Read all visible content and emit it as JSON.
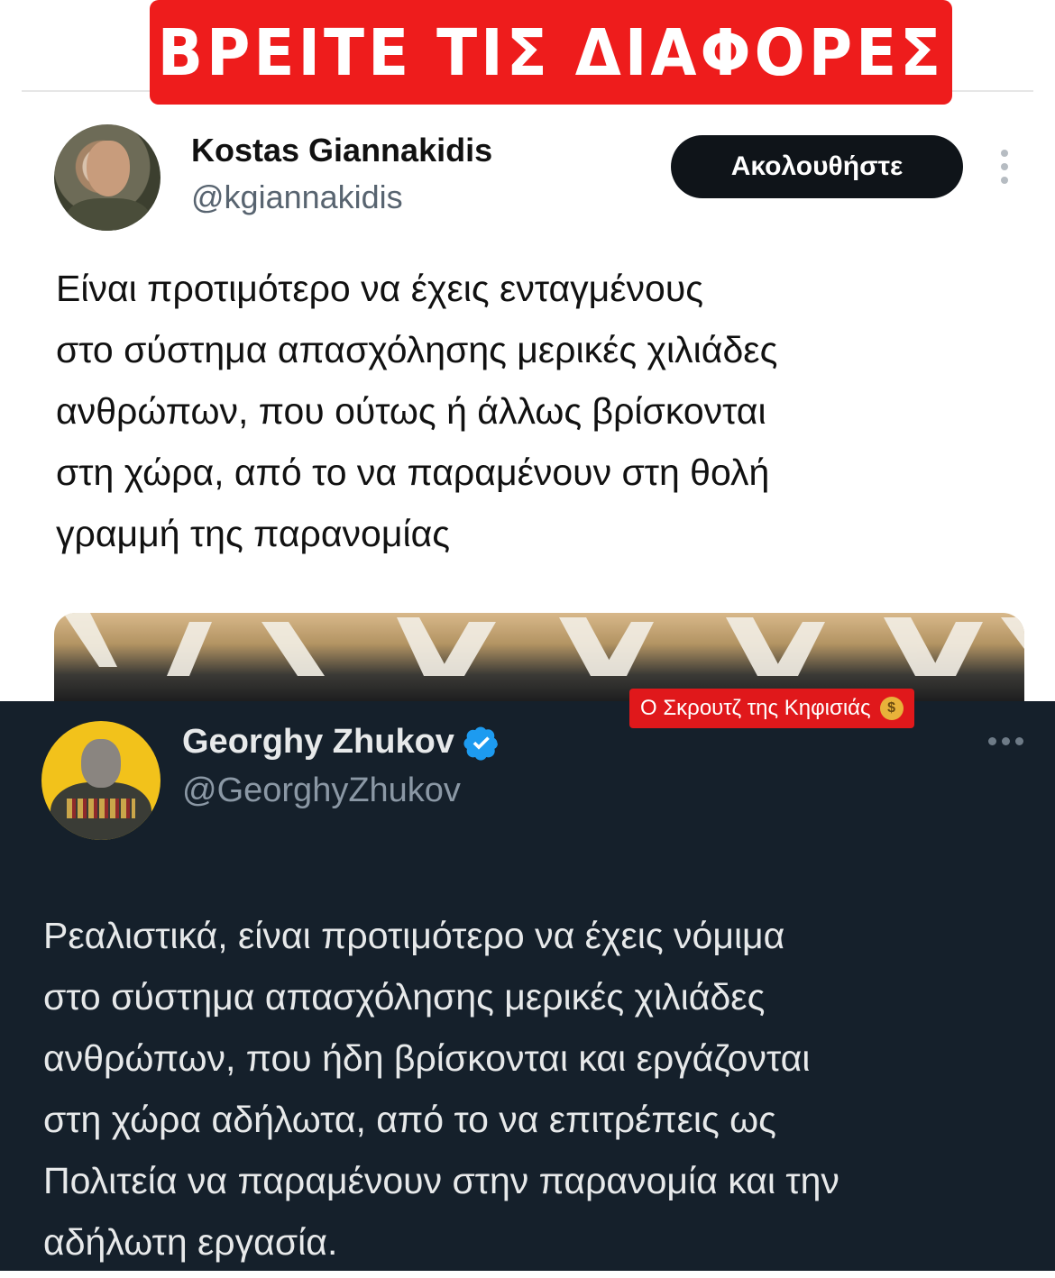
{
  "banner": {
    "title": "ΒΡΕΙΤΕ ΤΙΣ ΔΙΑΦΟΡΕΣ"
  },
  "tweet_light": {
    "author": "Kostas Giannakidis",
    "handle": "@kgiannakidis",
    "follow_label": "Ακολουθήστε",
    "avatar_icon": "profile-photo-icon",
    "more_icon": "more-vertical-icon",
    "text_lines": [
      "Είναι προτιμότερο να έχεις ενταγμένους",
      "στο σύστημα απασχόλησης μερικές χιλιάδες",
      "ανθρώπων, που ούτως ή άλλως βρίσκονται",
      "στη χώρα, από το να παραμένουν στη θολή",
      "γραμμή της παρανομίας"
    ]
  },
  "watermark": {
    "label": "Ο Σκρουτζ της Κηφισιάς",
    "icon": "money-bag-icon"
  },
  "tweet_dark": {
    "author": "Georghy Zhukov",
    "handle": "@GeorghyZhukov",
    "verified_icon": "verified-badge-icon",
    "more_icon": "more-horizontal-icon",
    "accent_color": "#1d9bf0",
    "text_lines": [
      "Ρεαλιστικά, είναι προτιμότερο να έχεις νόμιμα",
      "στο σύστημα απασχόλησης μερικές χιλιάδες",
      "ανθρώπων, που ήδη βρίσκονται και εργάζονται",
      "στη χώρα αδήλωτα, από το να επιτρέπεις ως",
      "Πολιτεία να παραμένουν στην παρανομία και την",
      "αδήλωτη εργασία."
    ]
  },
  "colors": {
    "banner_red": "#ee1c1c",
    "dark_bg": "#15202b",
    "light_bg": "#ffffff",
    "follow_button": "#0f1419"
  }
}
